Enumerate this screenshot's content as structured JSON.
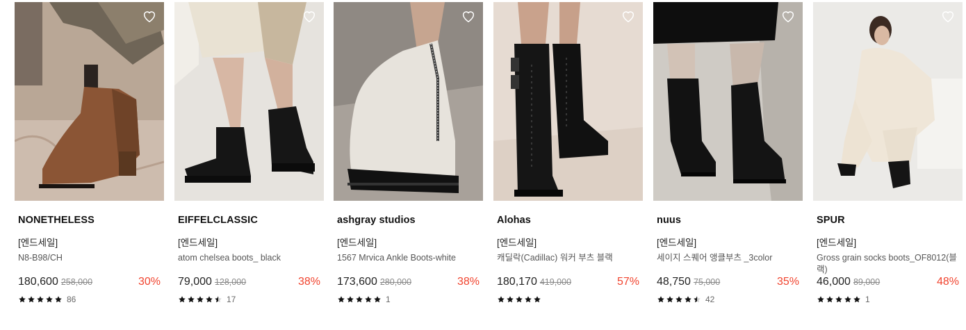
{
  "products": [
    {
      "brand": "NONETHELESS",
      "tag": "[엔드세일]",
      "name": "N8-B98/CH",
      "price": "180,600",
      "original_price": "258,000",
      "discount": "30%",
      "rating": 5,
      "reviews": "86",
      "bg": "#b4a294",
      "accent": "#6b4a30"
    },
    {
      "brand": "EIFFELCLASSIC",
      "tag": "[엔드세일]",
      "name": "atom chelsea boots_ black",
      "price": "79,000",
      "original_price": "128,000",
      "discount": "38%",
      "rating": 4.5,
      "reviews": "17",
      "bg": "#e8e5e0",
      "accent": "#141414"
    },
    {
      "brand": "ashgray studios",
      "tag": "[엔드세일]",
      "name": "1567 Mrvica Ankle Boots-white",
      "price": "173,600",
      "original_price": "280,000",
      "discount": "38%",
      "rating": 5,
      "reviews": "1",
      "bg": "#a59f98",
      "accent": "#e9e6e0"
    },
    {
      "brand": "Alohas",
      "tag": "[엔드세일]",
      "name": "캐딜락(Cadillac) 워커 부츠 블랙",
      "price": "180,170",
      "original_price": "419,000",
      "discount": "57%",
      "rating": 5,
      "reviews": "",
      "bg": "#e7ddd4",
      "accent": "#111111"
    },
    {
      "brand": "nuus",
      "tag": "[엔드세일]",
      "name": "세이지 스퀘어 앵클부츠 _3color",
      "price": "48,750",
      "original_price": "75,000",
      "discount": "35%",
      "rating": 4.5,
      "reviews": "42",
      "bg": "#cfccc6",
      "accent": "#121212"
    },
    {
      "brand": "SPUR",
      "tag": "[엔드세일]",
      "name": "Gross grain socks boots_OF8012(블랙)",
      "price": "46,000",
      "original_price": "89,000",
      "discount": "48%",
      "rating": 5,
      "reviews": "1",
      "bg": "#ecebe8",
      "accent": "#161616"
    }
  ],
  "icons": {
    "wishlist": "heart-icon",
    "star": "star-icon"
  }
}
